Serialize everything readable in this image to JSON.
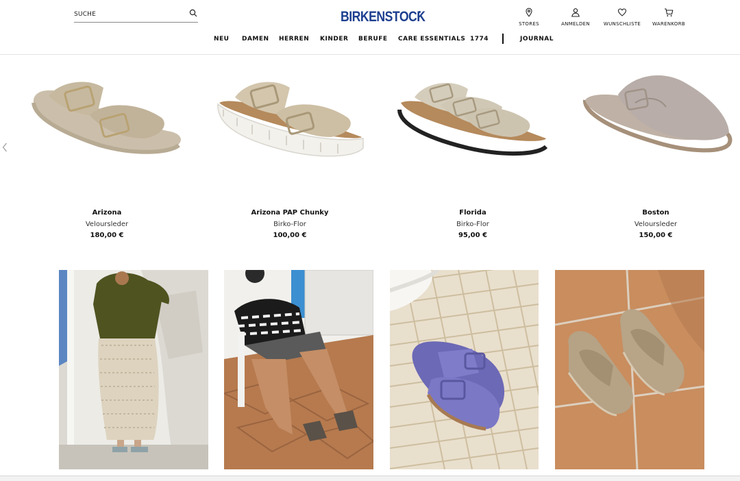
{
  "header": {
    "search_label": "SUCHE",
    "logo": "BIRKENSTOCK",
    "utility": {
      "stores": "STORES",
      "login": "ANMELDEN",
      "wishlist": "WUNSCHLISTE",
      "cart": "WARENKORB"
    },
    "nav": [
      "NEU",
      "DAMEN",
      "HERREN",
      "KINDER",
      "BERUFE",
      "CARE ESSENTIALS",
      "1774",
      "JOURNAL"
    ]
  },
  "products": [
    {
      "name": "Arizona",
      "material": "Veloursleder",
      "price": "180,00 €"
    },
    {
      "name": "Arizona PAP Chunky",
      "material": "Birko-Flor",
      "price": "100,00 €"
    },
    {
      "name": "Florida",
      "material": "Birko-Flor",
      "price": "95,00 €"
    },
    {
      "name": "Boston",
      "material": "Veloursleder",
      "price": "150,00 €"
    }
  ],
  "colors": {
    "brand": "#1d3f8f",
    "taupe": "#c2b59f",
    "cork": "#b58a5c",
    "lavender": "#7b78c6"
  },
  "icons": [
    "search-icon",
    "location-pin-icon",
    "user-icon",
    "heart-icon",
    "cart-icon",
    "chevron-left-icon"
  ]
}
